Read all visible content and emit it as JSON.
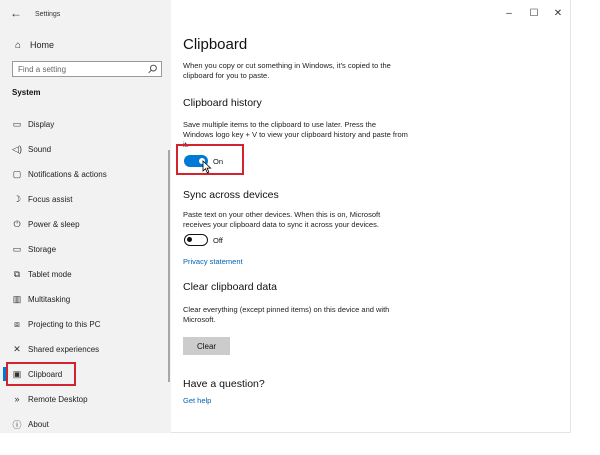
{
  "window": {
    "title": "Settings",
    "back_glyph": "←",
    "controls": {
      "minimize": "–",
      "maximize": "☐",
      "close": "✕"
    }
  },
  "sidebar": {
    "home": {
      "label": "Home",
      "icon": "home-icon"
    },
    "search": {
      "placeholder": "Find a setting",
      "icon": "search-icon"
    },
    "section": "System",
    "items": [
      {
        "label": "Display",
        "icon": "display-icon",
        "glyph": "▭"
      },
      {
        "label": "Sound",
        "icon": "speaker-icon",
        "glyph": "◁)"
      },
      {
        "label": "Notifications & actions",
        "icon": "notifications-icon",
        "glyph": "▢"
      },
      {
        "label": "Focus assist",
        "icon": "moon-icon",
        "glyph": "☽"
      },
      {
        "label": "Power & sleep",
        "icon": "power-icon",
        "glyph": "⏻"
      },
      {
        "label": "Storage",
        "icon": "storage-icon",
        "glyph": "▭"
      },
      {
        "label": "Tablet mode",
        "icon": "tablet-mode-icon",
        "glyph": "⧉"
      },
      {
        "label": "Multitasking",
        "icon": "multitasking-icon",
        "glyph": "▥"
      },
      {
        "label": "Projecting to this PC",
        "icon": "projecting-icon",
        "glyph": "⧈"
      },
      {
        "label": "Shared experiences",
        "icon": "shared-experiences-icon",
        "glyph": "✕"
      },
      {
        "label": "Clipboard",
        "icon": "clipboard-icon",
        "glyph": "▣"
      },
      {
        "label": "Remote Desktop",
        "icon": "remote-desktop-icon",
        "glyph": "»"
      },
      {
        "label": "About",
        "icon": "info-icon",
        "glyph": "ⓘ"
      }
    ],
    "selected": "Clipboard"
  },
  "main": {
    "title": "Clipboard",
    "intro": "When you copy or cut something in Windows, it's copied to the clipboard for you to paste.",
    "history": {
      "heading": "Clipboard history",
      "description": "Save multiple items to the clipboard to use later. Press the Windows logo key + V to view your clipboard history and paste from it.",
      "toggle_state": "On"
    },
    "sync": {
      "heading": "Sync across devices",
      "description": "Paste text on your other devices. When this is on, Microsoft receives your clipboard data to sync it across your devices.",
      "toggle_state": "Off",
      "privacy_link": "Privacy statement"
    },
    "clear": {
      "heading": "Clear clipboard data",
      "description": "Clear everything (except pinned items) on this device and with Microsoft.",
      "button": "Clear"
    },
    "question": {
      "heading": "Have a question?",
      "link": "Get help"
    }
  },
  "colors": {
    "accent": "#0078d7",
    "highlight": "#d1242f",
    "sidebar_bg": "#f2f2f2",
    "link": "#0063b1"
  }
}
